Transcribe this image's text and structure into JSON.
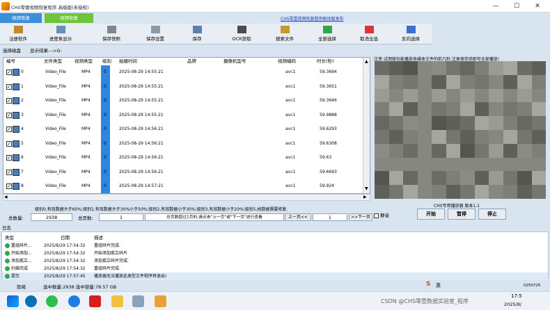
{
  "window": {
    "title": "CHS零壹视频恢复程序 高级版(未授权)",
    "notice": "CHS零壹视频恢复程序剧场版发布"
  },
  "tabs": [
    {
      "label": "视频恢复"
    },
    {
      "label": "视频修复"
    }
  ],
  "toolbar": [
    {
      "label": "注册软件",
      "icon": "register-icon"
    },
    {
      "label": "进度条显示",
      "icon": "progress-icon"
    },
    {
      "label": "保存快照",
      "icon": "snapshot-icon"
    },
    {
      "label": "保存设置",
      "icon": "settings-icon"
    },
    {
      "label": "保存",
      "icon": "save-icon"
    },
    {
      "label": "OCR获取",
      "icon": "ocr-icon"
    },
    {
      "label": "搜索文件",
      "icon": "search-icon"
    },
    {
      "label": "全部选择",
      "icon": "check-icon"
    },
    {
      "label": "取消全选",
      "icon": "cancel-icon"
    },
    {
      "label": "反向选择",
      "icon": "invert-icon"
    }
  ],
  "left": {
    "disk_label": "选择磁盘",
    "path_label": "显示结果--->G:"
  },
  "columns": [
    "编号",
    "文件类型",
    "视频类型",
    "级别",
    "拍摄时间",
    "品牌",
    "摄像机型号",
    "视频编码",
    "时长(秒)"
  ],
  "rows": [
    {
      "id": "0",
      "ftype": "Video_File",
      "vtype": "MP4",
      "level": "0",
      "time": "2025-08-29 14:55:21",
      "codec": "avc1",
      "dur": "59.3694"
    },
    {
      "id": "1",
      "ftype": "Video_File",
      "vtype": "MP4",
      "level": "0",
      "time": "2025-08-29 14:55:21",
      "codec": "avc1",
      "dur": "59.3651"
    },
    {
      "id": "2",
      "ftype": "Video_File",
      "vtype": "MP4",
      "level": "0",
      "time": "2025-08-29 14:55:21",
      "codec": "avc1",
      "dur": "59.3646"
    },
    {
      "id": "3",
      "ftype": "Video_File",
      "vtype": "MP4",
      "level": "0",
      "time": "2025-08-29 14:55:21",
      "codec": "avc1",
      "dur": "59.9888"
    },
    {
      "id": "4",
      "ftype": "Video_File",
      "vtype": "MP4",
      "level": "0",
      "time": "2025-08-29 14:56:21",
      "codec": "avc1",
      "dur": "59.6293"
    },
    {
      "id": "5",
      "ftype": "Video_File",
      "vtype": "MP4",
      "level": "0",
      "time": "2025-08-29 14:56:21",
      "codec": "avc1",
      "dur": "59.6308"
    },
    {
      "id": "6",
      "ftype": "Video_File",
      "vtype": "MP4",
      "level": "0",
      "time": "2025-08-29 14:56:21",
      "codec": "avc1",
      "dur": "59.63"
    },
    {
      "id": "7",
      "ftype": "Video_File",
      "vtype": "MP4",
      "level": "0",
      "time": "2025-08-29 14:56:21",
      "codec": "avc1",
      "dur": "59.6693"
    },
    {
      "id": "8",
      "ftype": "Video_File",
      "vtype": "MP4",
      "level": "0",
      "time": "2025-08-29 14:57:21",
      "codec": "avc1",
      "dur": "59.924"
    }
  ],
  "level_note": "级别0,有效数据大于60%;级别1,有效数据大于30%小于50%;级别2,有效数据小于30%;级别3,有效数据小于20%;级别5,帧数据需要修复.",
  "stats": {
    "total_label": "总数量:",
    "total": "2938",
    "pages_label": "总页数:",
    "pages": "1",
    "hint": "总页数超过1页的,请点击\"上一页\"或\"下一页\"进行查看",
    "prev": "上一页<<",
    "page": "1",
    "next": ">>下一页"
  },
  "preview": {
    "note": "注意:试用版仅能播放各媒体文件的前几秒,注册保存后即可全部播放!",
    "caption": "CHS专用播放器 版本1.1",
    "mute": "静音",
    "start": "开始",
    "pause": "暂停",
    "stop": "停止"
  },
  "log": {
    "label": "日志",
    "headers": [
      "类型",
      "日期",
      "描述"
    ],
    "rows": [
      {
        "type": "重组碎片...",
        "date": "2025/8/29 17:54:32",
        "desc": "重组碎片完成."
      },
      {
        "type": "开始添加...",
        "date": "2025/8/29 17:54:32",
        "desc": "开始添加孤立碎片"
      },
      {
        "type": "添加孤立...",
        "date": "2025/8/29 17:54:32",
        "desc": "添加孤立碎片完成."
      },
      {
        "type": "扫描完成",
        "date": "2025/8/29 17:54:32",
        "desc": "重组碎片完成."
      },
      {
        "type": "提示",
        "date": "2025/8/29 17:57:45",
        "desc": "播放器无法播放此类型文件程序将退出!"
      }
    ]
  },
  "status": {
    "label": "就绪",
    "selected": "选中数量:2938 选中容量:78.57 GB"
  },
  "taskbar": {
    "ime": "英",
    "clock": "17:5",
    "date": "2025/8/",
    "notif": "0250725"
  },
  "watermark": "CSDN @CHS零壹数据实验室_程序",
  "colors": {
    "level_blue": "#2f86e0",
    "tab_blue": "#3b8fd8",
    "tab_green": "#6fc43a"
  }
}
